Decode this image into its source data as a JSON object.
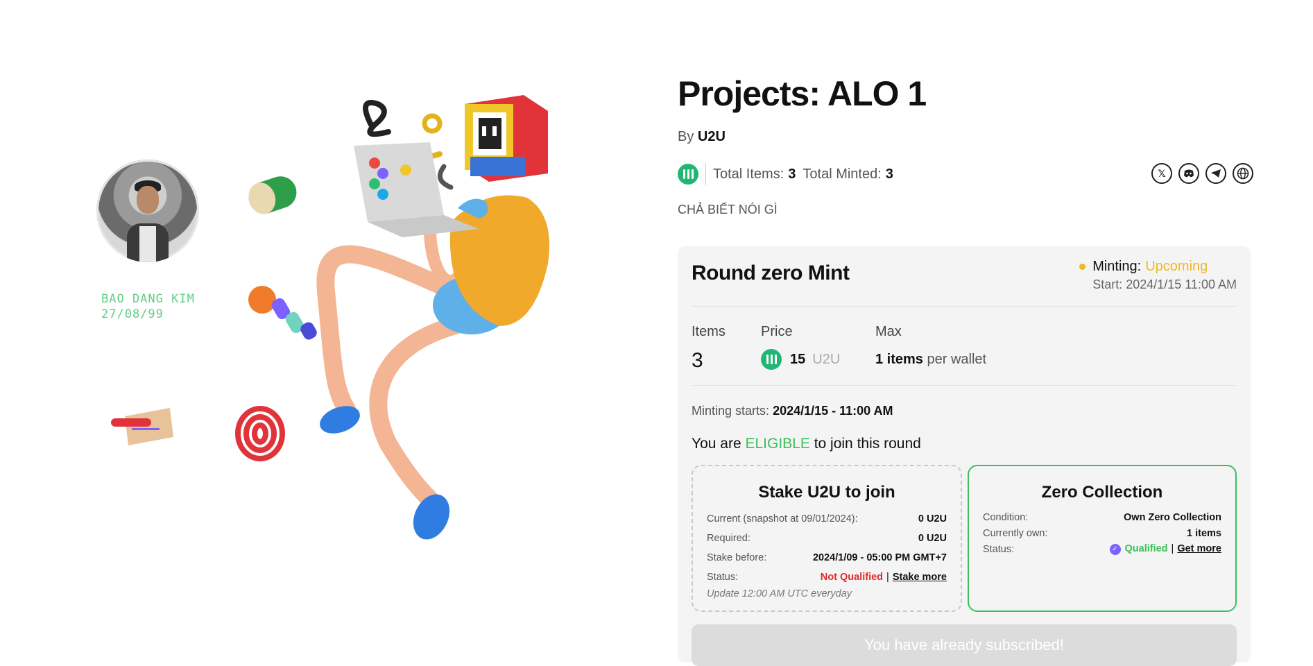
{
  "profile": {
    "name": "BAO DANG KIM",
    "date": "27/08/99"
  },
  "project": {
    "title": "Projects: ALO 1",
    "by_prefix": "By",
    "by_name": "U2U",
    "total_items_label": "Total Items:",
    "total_items_value": "3",
    "total_minted_label": "Total Minted:",
    "total_minted_value": "3",
    "description": "CHẢ BIẾT NÓI GÌ",
    "socials": [
      "x-icon",
      "discord-icon",
      "telegram-icon",
      "globe-icon"
    ]
  },
  "round": {
    "title": "Round zero Mint",
    "minting_label": "Minting:",
    "minting_status": "Upcoming",
    "start": "Start: 2024/1/15 11:00 AM",
    "items_label": "Items",
    "items_value": "3",
    "price_label": "Price",
    "price_value": "15",
    "price_unit": "U2U",
    "max_label": "Max",
    "max_value": "1 items",
    "max_suffix": "per wallet",
    "minting_starts_label": "Minting starts:",
    "minting_starts_value": "2024/1/15 - 11:00 AM",
    "eligible_pre": "You are",
    "eligible_word": "ELIGIBLE",
    "eligible_post": "to join this round",
    "subscribed_label": "You have already subscribed!"
  },
  "stake_box": {
    "title": "Stake U2U to join",
    "current_label": "Current (snapshot at 09/01/2024):",
    "current_value": "0 U2U",
    "required_label": "Required:",
    "required_value": "0 U2U",
    "stake_before_label": "Stake before:",
    "stake_before_value": "2024/1/09 - 05:00 PM GMT+7",
    "status_label": "Status:",
    "status_value": "Not Qualified",
    "action": "Stake more",
    "note": "Update 12:00 AM UTC everyday"
  },
  "zero_box": {
    "title": "Zero Collection",
    "condition_label": "Condition:",
    "condition_value": "Own Zero Collection",
    "own_label": "Currently own:",
    "own_value": "1 items",
    "status_label": "Status:",
    "status_value": "Qualified",
    "action": "Get more"
  },
  "colors": {
    "accent_green": "#3bbf5c",
    "coin_green": "#20b673",
    "upcoming_yellow": "#f2b81e",
    "not_qualified_red": "#e02b2b",
    "profile_text": "#5fce86"
  }
}
